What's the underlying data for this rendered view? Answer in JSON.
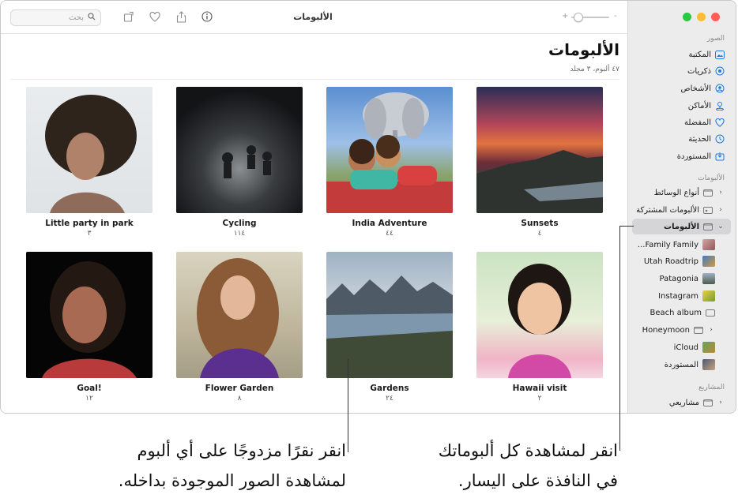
{
  "window": {
    "title": "الألبومات"
  },
  "toolbar": {
    "search_placeholder": "بحث",
    "zoom_minus": "-",
    "zoom_plus": "+"
  },
  "sidebar": {
    "section_photos": "الصور",
    "items": [
      {
        "label": "المكتبة",
        "icon": "library-icon"
      },
      {
        "label": "ذكريات",
        "icon": "memories-icon"
      },
      {
        "label": "الأشخاص",
        "icon": "people-icon"
      },
      {
        "label": "الأماكن",
        "icon": "places-icon"
      },
      {
        "label": "المفضلة",
        "icon": "heart-icon"
      },
      {
        "label": "الحديثة",
        "icon": "clock-icon"
      },
      {
        "label": "المستوردة",
        "icon": "import-icon"
      }
    ],
    "section_albums": "الألبومات",
    "album_groups": [
      {
        "label": "أنواع الوسائط"
      },
      {
        "label": "الألبومات المشتركة"
      },
      {
        "label": "الألبومات"
      }
    ],
    "albums": [
      {
        "label": "Family Family..."
      },
      {
        "label": "Utah Roadtrip"
      },
      {
        "label": "Patagonia"
      },
      {
        "label": "Instagram"
      },
      {
        "label": "Beach album"
      },
      {
        "label": "Honeymoon"
      },
      {
        "label": "iCloud"
      },
      {
        "label": "المستوردة"
      }
    ],
    "section_projects": "المشاريع",
    "projects": [
      {
        "label": "مشاريعي"
      }
    ]
  },
  "main": {
    "title": "الألبومات",
    "subtitle": "٤٧ ألبوم، ٣ مجلد",
    "albums": [
      {
        "name": "Sunsets",
        "count": "٤"
      },
      {
        "name": "India Adventure",
        "count": "٤٤"
      },
      {
        "name": "Cycling",
        "count": "١١٤"
      },
      {
        "name": "Little party in park",
        "count": "٣"
      },
      {
        "name": "Hawaii visit",
        "count": "٢"
      },
      {
        "name": "Gardens",
        "count": "٢٤"
      },
      {
        "name": "Flower Garden",
        "count": "٨"
      },
      {
        "name": "Goal!",
        "count": "١٢"
      }
    ]
  },
  "callouts": {
    "right_line1": "انقر لمشاهدة كل ألبوماتك",
    "right_line2": "في النافذة على اليسار.",
    "left_line1": "انقر نقرًا مزدوجًا على أي ألبوم",
    "left_line2": "لمشاهدة الصور الموجودة بداخله."
  },
  "colors": {
    "accent": "#1f7ae0",
    "close": "#ff5f57",
    "minimize": "#febc2e",
    "zoom": "#28c840"
  }
}
